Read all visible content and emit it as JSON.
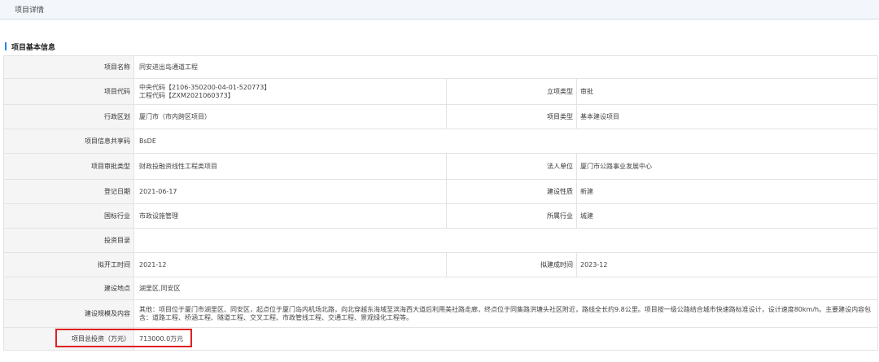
{
  "header": {
    "tab_label": "项目详情"
  },
  "section": {
    "title": "项目基本信息"
  },
  "fields": {
    "project_name_label": "项目名称",
    "project_name": "同安进出岛通道工程",
    "project_code_label": "项目代码",
    "project_code_central": "中央代码【2106-350200-04-01-520773】",
    "project_code_engineering": "工程代码【ZXM2021060373】",
    "approval_type_label": "立项类型",
    "approval_type": "审批",
    "admin_region_label": "行政区划",
    "admin_region": "厦门市（市内跨区项目）",
    "project_category_label": "项目类型",
    "project_category": "基本建设项目",
    "share_code_label": "项目信息共享码",
    "share_code": "BsDE",
    "review_type_label": "项目审批类型",
    "review_type": "财政投融资线性工程类项目",
    "legal_unit_label": "法人单位",
    "legal_unit": "厦门市公路事业发展中心",
    "register_date_label": "登记日期",
    "register_date": "2021-06-17",
    "construction_nature_label": "建设性质",
    "construction_nature": "新建",
    "national_industry_label": "国标行业",
    "national_industry": "市政设施管理",
    "industry_label": "所属行业",
    "industry": "城建",
    "investment_catalog_label": "投资目录",
    "investment_catalog": "",
    "start_time_label": "拟开工时间",
    "start_time": "2021-12",
    "completion_time_label": "拟建成时间",
    "completion_time": "2023-12",
    "location_label": "建设地点",
    "location": "湖里区,同安区",
    "scale_label": "建设规模及内容",
    "scale": "其他：项目位于厦门市湖里区、同安区，起点位于厦门岛内机场北路，向北穿越东海域至滨海西大道后利用美社路走廊，终点位于同集路洪塘头社区附近，路线全长约9.8公里。项目按一级公路结合城市快速路标准设计，设计速度80km/h。主要建设内容包含：道路工程、桥涵工程、隧道工程、交叉工程、市政管线工程、交通工程、景观绿化工程等。",
    "total_investment_label": "项目总投资（万元）",
    "total_investment": "713000.0万元"
  },
  "colors": {
    "accent": "#2d7fe0",
    "highlight": "#e02020"
  }
}
